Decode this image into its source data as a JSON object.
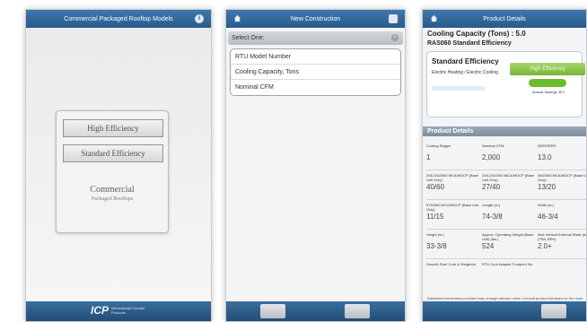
{
  "screen1": {
    "title": "Commercial Packaged Rooftop Models",
    "info_glyph": "i",
    "buttons": [
      {
        "label": "High Efficiency"
      },
      {
        "label": "Standard Efficiency"
      }
    ],
    "brand_title": "Commercial",
    "brand_subtitle": "Packaged Rooftops",
    "logo_mark": "ICP",
    "logo_text": "International Comfort Products"
  },
  "screen2": {
    "title": "New Construction",
    "select_label": "Select One:",
    "close_glyph": "×",
    "options": [
      {
        "label": "RTU Model Number"
      },
      {
        "label": "Cooling Capacity, Tons"
      },
      {
        "label": "Nominal CFM"
      }
    ]
  },
  "screen3": {
    "title": "Product Details",
    "capacity_heading": "Cooling Capacity (Tons) : 5.0",
    "model": "RAS060 Standard Efficiency",
    "efficiency_title": "Standard Efficiency",
    "efficiency_desc": "Electric Heating / Electric Cooling",
    "high_eff_button": "High Efficiency",
    "savings_label": "Annual Savings, $Yr",
    "section_title": "Product Details",
    "specs": [
      [
        {
          "label": "Cooling Stages",
          "value": "1"
        },
        {
          "label": "Nominal CFM",
          "value": "2,000"
        },
        {
          "label": "SEER/EER",
          "value": "13.0"
        }
      ],
      [
        {
          "label": "208-230/3/60 MCA/MOCP (Base Unit Only)",
          "value": "40/60"
        },
        {
          "label": "208-230/3/60 MCA/MOCP (Base Unit Only)",
          "value": "27/40"
        },
        {
          "label": "460/3/60 MCA/MOCP (Base Unit Only)",
          "value": "13/20"
        }
      ],
      [
        {
          "label": "575/3/60 MCA/MOCP (Base Unit Only)",
          "value": "11/15"
        },
        {
          "label": "Length (in.)",
          "value": "74-3/8"
        },
        {
          "label": "Width (in.)",
          "value": "46-3/4"
        }
      ],
      [
        {
          "label": "Height (in.)",
          "value": "33-3/8"
        },
        {
          "label": "Approx. Operating Weight (Base Unit) (lbs.)",
          "value": "524"
        },
        {
          "label": "Max Vertical External Static (in.) (TPA, BPH)",
          "value": "2.0+"
        }
      ],
      [
        {
          "label": "Smooth Roof Curb & Weighout",
          "value": ""
        },
        {
          "label": "RTU Curb Adapter Footprint No.",
          "value": ""
        },
        {
          "label": "",
          "value": ""
        }
      ]
    ],
    "disclaimer": "Datasheet information provided may change without notice. Consult product literature for the most current information."
  },
  "colors": {
    "header": "#2a5a8a",
    "high_eff_green": "#79b53b"
  }
}
